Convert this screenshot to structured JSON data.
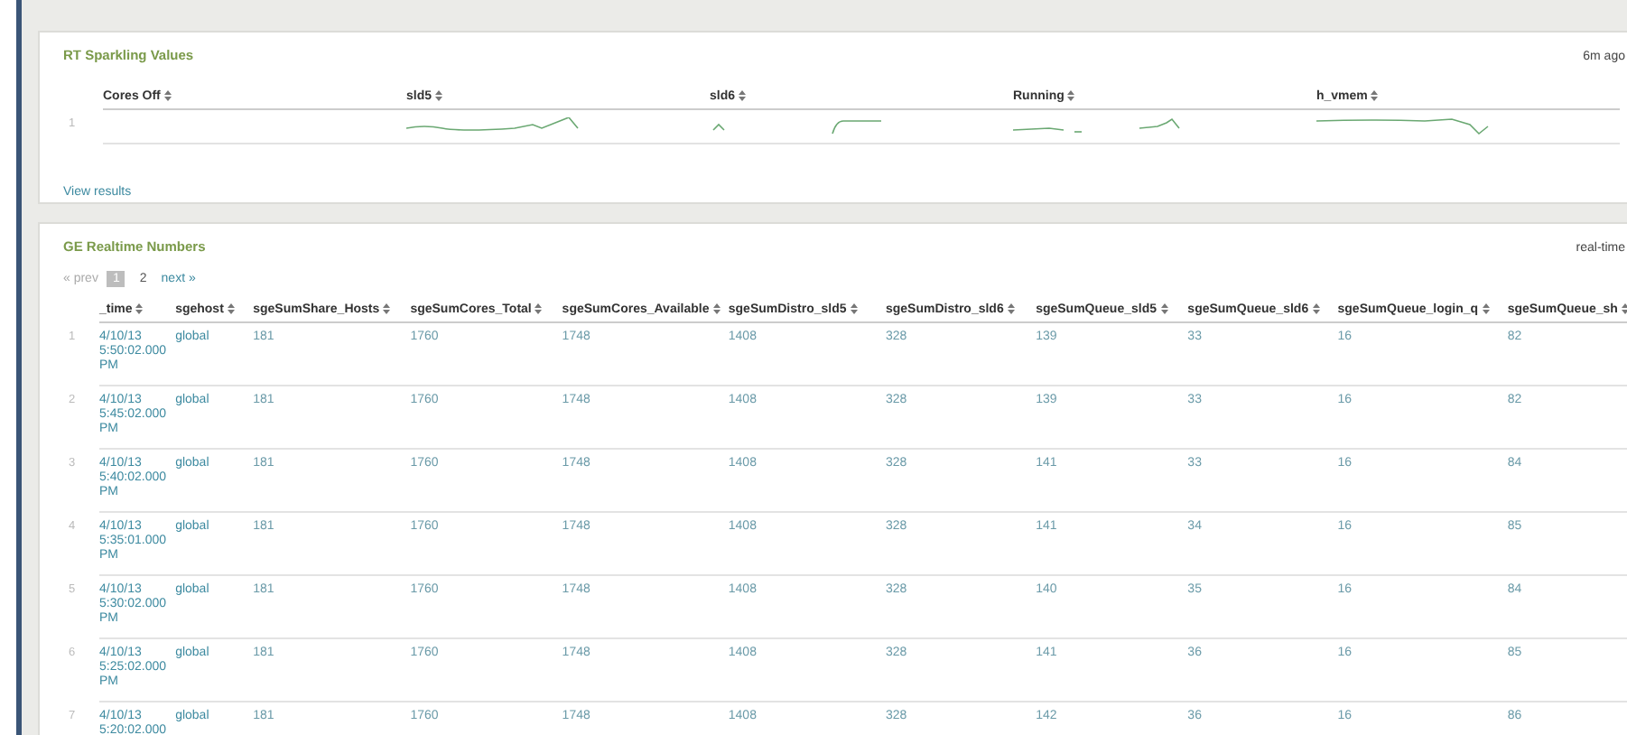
{
  "sparkline_panel": {
    "title": "RT Sparkling Values",
    "updated": "6m ago",
    "columns": [
      "Cores Off",
      "sld5",
      "sld6",
      "Running",
      "h_vmem"
    ],
    "rows": [
      {
        "number": "1",
        "cells": [
          {
            "kind": "empty"
          },
          {
            "kind": "sparkline"
          },
          {
            "kind": "sparkline"
          },
          {
            "kind": "sparkline"
          },
          {
            "kind": "sparkline"
          }
        ]
      }
    ],
    "link": "View results"
  },
  "numbers_panel": {
    "title": "GE Realtime Numbers",
    "mode": "real-time",
    "pagination": {
      "prev": "« prev",
      "pages": [
        {
          "label": "1",
          "selected": true
        },
        {
          "label": "2",
          "selected": false
        }
      ],
      "next": "next »"
    },
    "columns": [
      "_time",
      "sgehost",
      "sgeSumShare_Hosts",
      "sgeSumCores_Total",
      "sgeSumCores_Available",
      "sgeSumDistro_sld5",
      "sgeSumDistro_sld6",
      "sgeSumQueue_sld5",
      "sgeSumQueue_sld6",
      "sgeSumQueue_login_q",
      "sgeSumQueue_sh"
    ],
    "rows": [
      {
        "number": "1",
        "cells": [
          "4/10/13 5:50:02.000 PM",
          "global",
          "181",
          "1760",
          "1748",
          "1408",
          "328",
          "139",
          "33",
          "16",
          "82"
        ]
      },
      {
        "number": "2",
        "cells": [
          "4/10/13 5:45:02.000 PM",
          "global",
          "181",
          "1760",
          "1748",
          "1408",
          "328",
          "139",
          "33",
          "16",
          "82"
        ]
      },
      {
        "number": "3",
        "cells": [
          "4/10/13 5:40:02.000 PM",
          "global",
          "181",
          "1760",
          "1748",
          "1408",
          "328",
          "141",
          "33",
          "16",
          "84"
        ]
      },
      {
        "number": "4",
        "cells": [
          "4/10/13 5:35:01.000 PM",
          "global",
          "181",
          "1760",
          "1748",
          "1408",
          "328",
          "141",
          "34",
          "16",
          "85"
        ]
      },
      {
        "number": "5",
        "cells": [
          "4/10/13 5:30:02.000 PM",
          "global",
          "181",
          "1760",
          "1748",
          "1408",
          "328",
          "140",
          "35",
          "16",
          "84"
        ]
      },
      {
        "number": "6",
        "cells": [
          "4/10/13 5:25:02.000 PM",
          "global",
          "181",
          "1760",
          "1748",
          "1408",
          "328",
          "141",
          "36",
          "16",
          "85"
        ]
      },
      {
        "number": "7",
        "cells": [
          "4/10/13 5:20:02.000",
          "global",
          "181",
          "1760",
          "1748",
          "1408",
          "328",
          "142",
          "36",
          "16",
          "86"
        ]
      }
    ]
  }
}
